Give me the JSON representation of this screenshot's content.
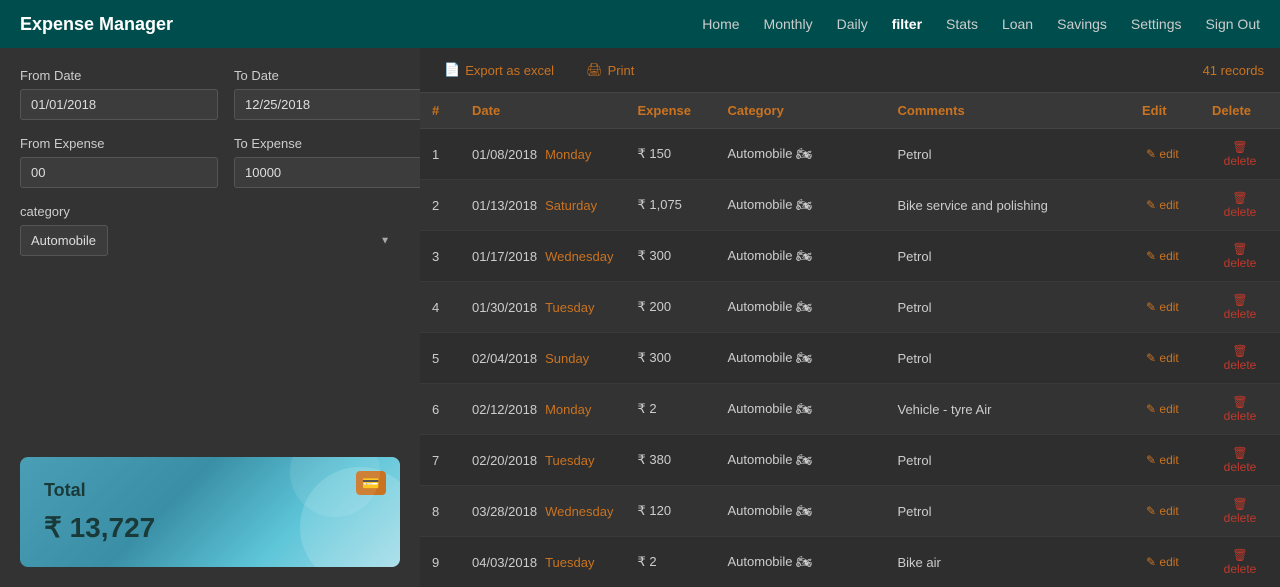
{
  "nav": {
    "brand": "Expense Manager",
    "links": [
      {
        "label": "Home",
        "active": false
      },
      {
        "label": "Monthly",
        "active": false
      },
      {
        "label": "Daily",
        "active": false
      },
      {
        "label": "filter",
        "active": true
      },
      {
        "label": "Stats",
        "active": false
      },
      {
        "label": "Loan",
        "active": false
      },
      {
        "label": "Savings",
        "active": false
      },
      {
        "label": "Settings",
        "active": false
      },
      {
        "label": "Sign Out",
        "active": false
      }
    ]
  },
  "sidebar": {
    "from_date_label": "From Date",
    "from_date_value": "01/01/2018",
    "to_date_label": "To Date",
    "to_date_value": "12/25/2018",
    "from_expense_label": "From Expense",
    "from_expense_value": "00",
    "to_expense_label": "To Expense",
    "to_expense_value": "10000",
    "category_label": "category",
    "category_value": "Automobile",
    "total_label": "Total",
    "total_amount": "₹ 13,727"
  },
  "toolbar": {
    "export_label": "Export as excel",
    "print_label": "Print",
    "records_label": "41 records"
  },
  "table": {
    "headers": [
      "#",
      "Date",
      "Expense",
      "Category",
      "Comments",
      "Edit",
      "Delete"
    ],
    "rows": [
      {
        "num": 1,
        "date": "01/08/2018",
        "day": "Monday",
        "expense": "₹ 150",
        "category": "Automobile 🏍",
        "comments": "Petrol"
      },
      {
        "num": 2,
        "date": "01/13/2018",
        "day": "Saturday",
        "expense": "₹ 1,075",
        "category": "Automobile 🏍",
        "comments": "Bike service and polishing"
      },
      {
        "num": 3,
        "date": "01/17/2018",
        "day": "Wednesday",
        "expense": "₹ 300",
        "category": "Automobile 🏍",
        "comments": "Petrol"
      },
      {
        "num": 4,
        "date": "01/30/2018",
        "day": "Tuesday",
        "expense": "₹ 200",
        "category": "Automobile 🏍",
        "comments": "Petrol"
      },
      {
        "num": 5,
        "date": "02/04/2018",
        "day": "Sunday",
        "expense": "₹ 300",
        "category": "Automobile 🏍",
        "comments": "Petrol"
      },
      {
        "num": 6,
        "date": "02/12/2018",
        "day": "Monday",
        "expense": "₹ 2",
        "category": "Automobile 🏍",
        "comments": "Vehicle - tyre Air"
      },
      {
        "num": 7,
        "date": "02/20/2018",
        "day": "Tuesday",
        "expense": "₹ 380",
        "category": "Automobile 🏍",
        "comments": "Petrol"
      },
      {
        "num": 8,
        "date": "03/28/2018",
        "day": "Wednesday",
        "expense": "₹ 120",
        "category": "Automobile 🏍",
        "comments": "Petrol"
      },
      {
        "num": 9,
        "date": "04/03/2018",
        "day": "Tuesday",
        "expense": "₹ 2",
        "category": "Automobile 🏍",
        "comments": "Bike air"
      }
    ],
    "edit_label": "edit",
    "delete_label": "delete"
  }
}
